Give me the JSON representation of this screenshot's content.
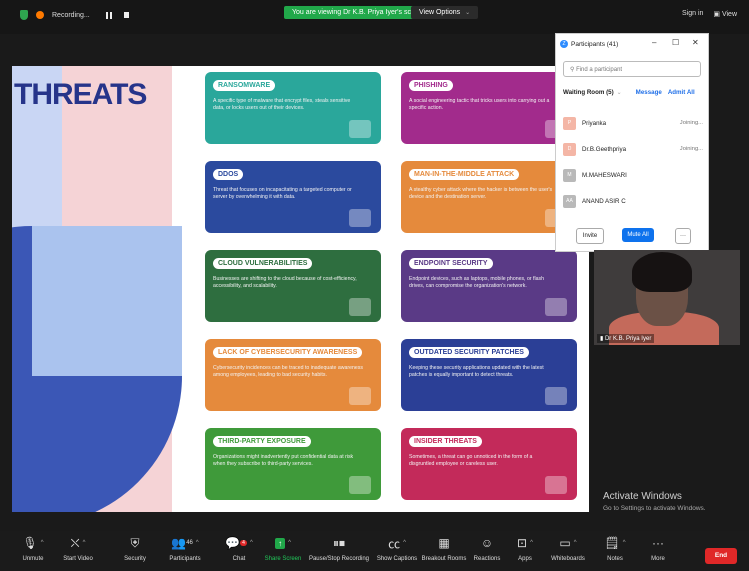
{
  "topbar": {
    "recording": "Recording...",
    "viewing": "You are viewing Dr K.B. Priya Iyer's screen",
    "view_options": "View Options",
    "sign_in": "Sign in",
    "view": "View"
  },
  "slide": {
    "title": "THREATS",
    "cards": [
      {
        "tag": "RANSOMWARE",
        "desc": "A specific type of malware that encrypt files, steals sensitive data, or locks users out of their devices.",
        "color": "#2aa79b"
      },
      {
        "tag": "PHISHING",
        "desc": "A social engineering tactic that tricks users into carrying out a specific action.",
        "color": "#a22b8c"
      },
      {
        "tag": "DDOS",
        "desc": "Threat that focuses on incapacitating a targeted computer or server by overwhelming it with data.",
        "color": "#2b4a9e"
      },
      {
        "tag": "MAN-IN-THE-MIDDLE ATTACK",
        "desc": "A stealthy cyber attack where the hacker is between the user's device and the destination server.",
        "color": "#e58a3c"
      },
      {
        "tag": "CLOUD VULNERABILITIES",
        "desc": "Businesses are shifting to the cloud because of cost-efficiency, accessibility, and scalability.",
        "color": "#2e6e3f"
      },
      {
        "tag": "ENDPOINT SECURITY",
        "desc": "Endpoint devices, such as laptops, mobile phones, or flash drives, can compromise the organization's network.",
        "color": "#5a3a86"
      },
      {
        "tag": "LACK OF CYBERSECURITY AWARENESS",
        "desc": "Cybersecurity incidences can be traced to inadequate awareness among employees, leading to bad security habits.",
        "color": "#e58a3c"
      },
      {
        "tag": "OUTDATED SECURITY PATCHES",
        "desc": "Keeping these security applications updated with the latest patches is equally important to detect threats.",
        "color": "#2b3f96"
      },
      {
        "tag": "THIRD-PARTY EXPOSURE",
        "desc": "Organizations might inadvertently put confidential data at risk when they subscribe to third-party services.",
        "color": "#3f9a3a"
      },
      {
        "tag": "INSIDER THREATS",
        "desc": "Sometimes, a threat can go unnoticed in the form of a disgruntled employee or careless user.",
        "color": "#c32a5a"
      }
    ]
  },
  "participants_panel": {
    "title": "Participants (41)",
    "search_placeholder": "Find a participant",
    "waiting_room": "Waiting Room (5)",
    "message": "Message",
    "admit_all": "Admit All",
    "people": [
      {
        "initial": "P",
        "name": "Priyanka",
        "status": "Joining...",
        "color": "#f4b6a6"
      },
      {
        "initial": "D",
        "name": "Dr.B.Geethpriya",
        "status": "Joining...",
        "color": "#f4b6a6"
      },
      {
        "initial": "M",
        "name": "M.MAHESWARI",
        "status": "",
        "color": "#b9b9b9"
      },
      {
        "initial": "AA",
        "name": "ANAND ASIR C",
        "status": "",
        "color": "#b9b9b9"
      }
    ],
    "invite": "Invite",
    "mute_all": "Mute All",
    "more": "···"
  },
  "video": {
    "name": "Dr K.B. Priya Iyer"
  },
  "activate": {
    "line1": "Activate Windows",
    "line2": "Go to Settings to activate Windows."
  },
  "toolbar": {
    "unmute": "Unmute",
    "start_video": "Start Video",
    "security": "Security",
    "participants": "Participants",
    "participants_count": "46",
    "chat": "Chat",
    "chat_badge": "4",
    "share_screen": "Share Screen",
    "pause_stop": "Pause/Stop Recording",
    "captions": "Show Captions",
    "breakout": "Breakout Rooms",
    "reactions": "Reactions",
    "apps": "Apps",
    "whiteboards": "Whiteboards",
    "notes": "Notes",
    "more": "More",
    "end": "End"
  }
}
